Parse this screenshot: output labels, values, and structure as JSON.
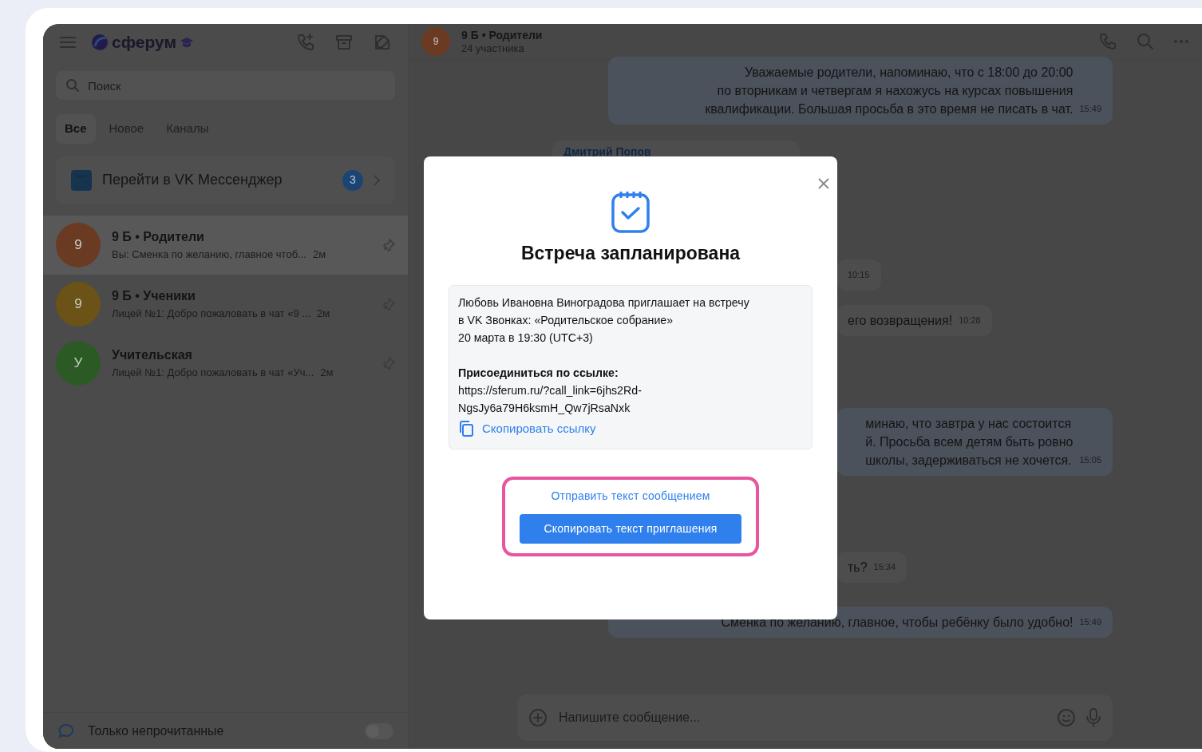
{
  "sidebar": {
    "logo": "сферум",
    "search": {
      "placeholder": "Поиск"
    },
    "tabs": [
      {
        "label": "Все",
        "selected": true
      },
      {
        "label": "Новое",
        "selected": false
      },
      {
        "label": "Каналы",
        "selected": false
      }
    ],
    "banner": {
      "label": "Перейти в VK Мессенджер",
      "badge": "3"
    },
    "chats": [
      {
        "avatar": "9",
        "color": "#6b3a22",
        "name": "9 Б • Родители",
        "preview": "Вы: Сменка по желанию, главное чтоб...",
        "time": "2м",
        "pinned": true,
        "selected": true
      },
      {
        "avatar": "9",
        "color": "#6b5216",
        "name": "9 Б • Ученики",
        "preview": "Лицей №1: Добро пожаловать в чат «9 ...",
        "time": "2м",
        "pinned": true,
        "selected": false
      },
      {
        "avatar": "У",
        "color": "#2c5a25",
        "name": "Учительская",
        "preview": "Лицей №1: Добро пожаловать в чат «Уч...",
        "time": "2м",
        "pinned": true,
        "selected": false
      }
    ],
    "unread_filter": {
      "label": "Только непрочитанные",
      "on": false
    }
  },
  "chat": {
    "avatar": "9",
    "title": "9 Б • Родители",
    "subtitle": "24 участника",
    "messages": [
      {
        "kind": "out",
        "text": "Уважаемые родители, напоминаю, что с 18:00 до 20:00\nпо вторникам и четвергам я нахожусь на курсах повышения\nквалификации. Большая просьба в это время не писать в чат.",
        "time": "15:49"
      },
      {
        "kind": "sender",
        "text": "Дмитрий  Попов"
      },
      {
        "kind": "in",
        "time": "10:15"
      },
      {
        "kind": "in",
        "text": "его возвращения!",
        "time": "10:28"
      },
      {
        "kind": "out_cut",
        "text": "минаю, что завтра у нас состоится\nй. Просьба всем детям быть ровно\nшколы, задерживаться не хочется.",
        "time": "15:05"
      },
      {
        "kind": "in",
        "text": "ть?",
        "time": "15:34"
      },
      {
        "kind": "out",
        "text": "Сменка по желанию, главное, чтобы ребёнку было удобно!",
        "time": "15:49"
      }
    ],
    "composer": {
      "placeholder": "Напишите сообщение..."
    }
  },
  "modal": {
    "title": "Встреча запланирована",
    "invitation": {
      "text": "Любовь Ивановна Виноградова приглашает на встречу в VK Звонках: «Родительское собрание»",
      "date": "20 марта в 19:30 (UTC+3)",
      "join_label": "Присоединиться по ссылке:",
      "link": "https://sferum.ru/?call_link=6jhs2Rd-NgsJy6a79H6ksmH_Qw7jRsaNxk",
      "copy_link": "Скопировать ссылку"
    },
    "send_link": "Отправить текст сообщением",
    "copy_button": "Скопировать текст приглашения",
    "highlighted": true
  }
}
